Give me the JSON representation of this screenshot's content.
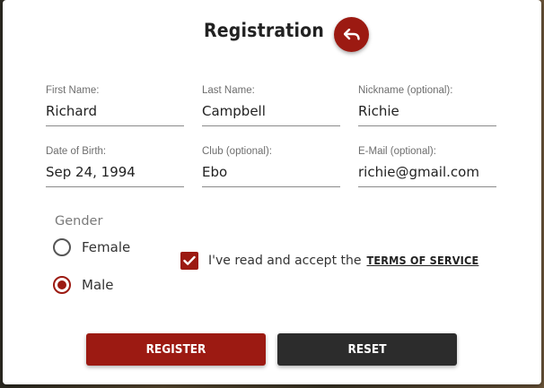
{
  "dialog": {
    "title": "Registration"
  },
  "fields": [
    {
      "label": "First Name:",
      "value": "Richard"
    },
    {
      "label": "Last Name:",
      "value": "Campbell"
    },
    {
      "label": "Nickname (optional):",
      "value": "Richie"
    },
    {
      "label": "Date of Birth:",
      "value": "Sep 24, 1994"
    },
    {
      "label": "Club (optional):",
      "value": "Ebo"
    },
    {
      "label": "E-Mail (optional):",
      "value": "richie@gmail.com"
    }
  ],
  "gender": {
    "label": "Gender",
    "options": [
      {
        "label": "Female",
        "checked": false
      },
      {
        "label": "Male",
        "checked": true
      }
    ]
  },
  "terms": {
    "checked": true,
    "text": "I've read and accept the",
    "link": "TERMS OF SERVICE"
  },
  "actions": {
    "register": "REGISTER",
    "reset": "RESET"
  },
  "colors": {
    "accent": "#9c1a12",
    "dark_button": "#2c2c2c"
  },
  "icons": {
    "back": "undo-arrow-icon",
    "check": "checkmark-icon"
  }
}
